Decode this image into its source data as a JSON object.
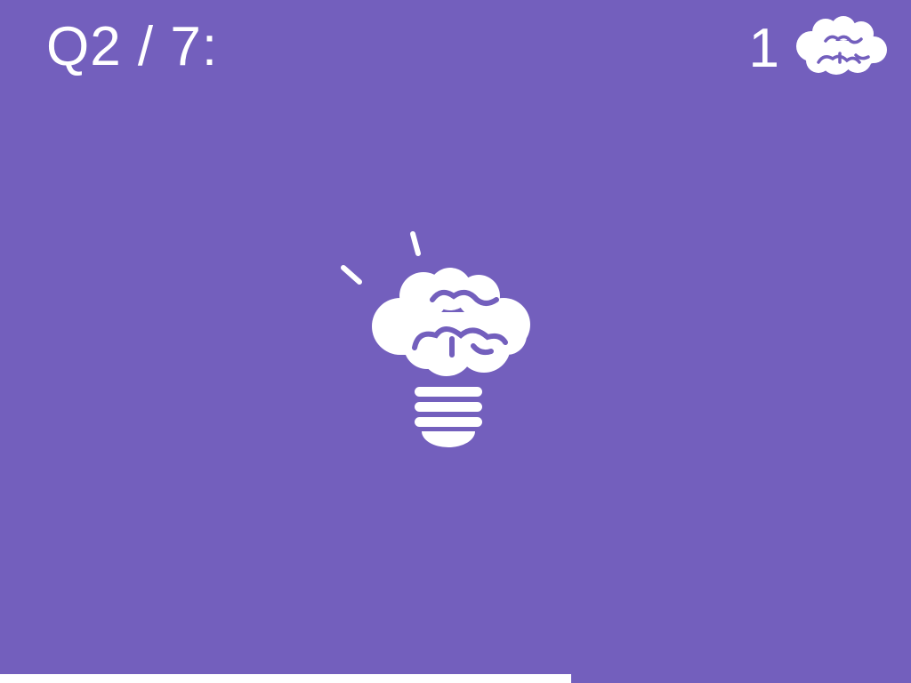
{
  "header": {
    "question_counter": "Q2 / 7:",
    "score": "1",
    "score_icon": "brain-icon"
  },
  "main": {
    "hint_icon": "lightbulb-brain-icon"
  },
  "progress": {
    "fraction": 0.627
  },
  "colors": {
    "background": "#735fbd",
    "foreground": "#ffffff"
  }
}
